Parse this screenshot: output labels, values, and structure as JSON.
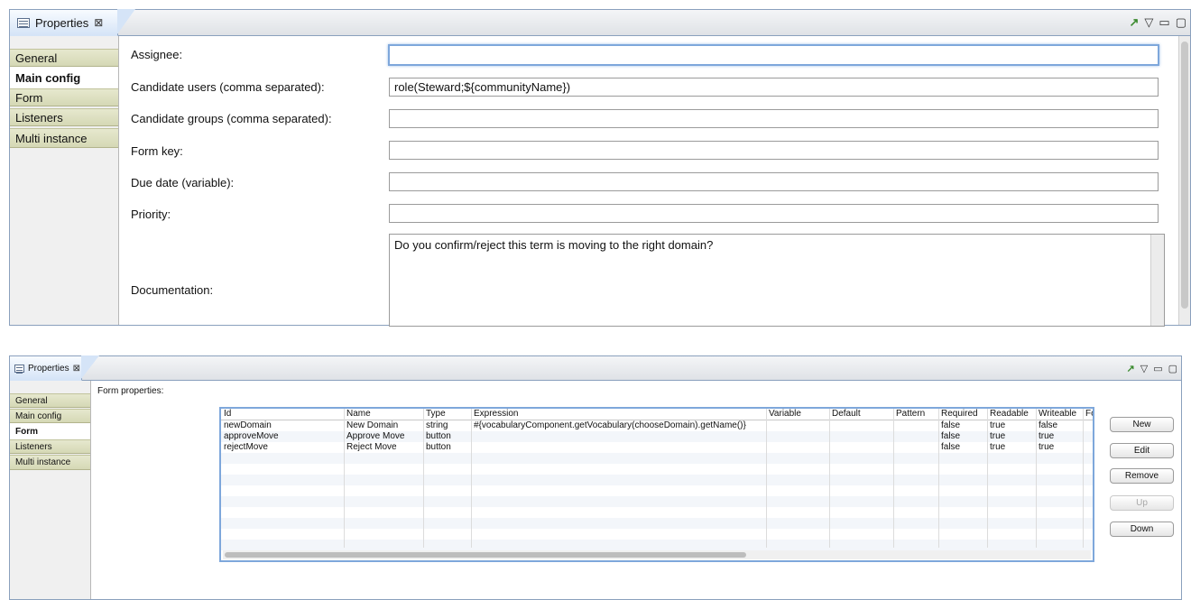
{
  "top_view": {
    "tab_title": "Properties",
    "close_glyph": "⊠",
    "view_controls": {
      "pin_icon": "↗",
      "menu_icon": "▽",
      "minimize_icon": "▭",
      "maximize_icon": "▢"
    },
    "sidebar": [
      {
        "label": "General",
        "active": false
      },
      {
        "label": "Main config",
        "active": true
      },
      {
        "label": "Form",
        "active": false
      },
      {
        "label": "Listeners",
        "active": false
      },
      {
        "label": "Multi instance",
        "active": false
      }
    ],
    "fields": {
      "assignee": {
        "label": "Assignee:",
        "value": ""
      },
      "candidate_users": {
        "label": "Candidate users (comma separated):",
        "value": "role(Steward;${communityName})"
      },
      "candidate_groups": {
        "label": "Candidate groups (comma separated):",
        "value": ""
      },
      "form_key": {
        "label": "Form key:",
        "value": ""
      },
      "due_date": {
        "label": "Due date (variable):",
        "value": ""
      },
      "priority": {
        "label": "Priority:",
        "value": ""
      },
      "documentation": {
        "label": "Documentation:",
        "value": "Do you confirm/reject this term is moving to the right domain?"
      }
    }
  },
  "bottom_view": {
    "tab_title": "Properties",
    "close_glyph": "⊠",
    "view_controls": {
      "pin_icon": "↗",
      "menu_icon": "▽",
      "minimize_icon": "▭",
      "maximize_icon": "▢"
    },
    "sidebar": [
      {
        "label": "General",
        "active": false
      },
      {
        "label": "Main config",
        "active": false
      },
      {
        "label": "Form",
        "active": true
      },
      {
        "label": "Listeners",
        "active": false
      },
      {
        "label": "Multi instance",
        "active": false
      }
    ],
    "form_properties_label": "Form properties:",
    "table": {
      "columns": [
        "Id",
        "Name",
        "Type",
        "Expression",
        "Variable",
        "Default",
        "Pattern",
        "Required",
        "Readable",
        "Writeable",
        "Fo"
      ],
      "rows": [
        [
          "newDomain",
          "New Domain",
          "string",
          "#{vocabularyComponent.getVocabulary(chooseDomain).getName()}",
          "",
          "",
          "",
          "false",
          "true",
          "false",
          ""
        ],
        [
          "approveMove",
          "Approve Move",
          "button",
          "",
          "",
          "",
          "",
          "false",
          "true",
          "true",
          ""
        ],
        [
          "rejectMove",
          "Reject Move",
          "button",
          "",
          "",
          "",
          "",
          "false",
          "true",
          "true",
          ""
        ]
      ]
    },
    "buttons": [
      {
        "label": "New",
        "enabled": true
      },
      {
        "label": "Edit",
        "enabled": true
      },
      {
        "label": "Remove",
        "enabled": true
      },
      {
        "label": "Up",
        "enabled": false
      },
      {
        "label": "Down",
        "enabled": true
      }
    ]
  }
}
